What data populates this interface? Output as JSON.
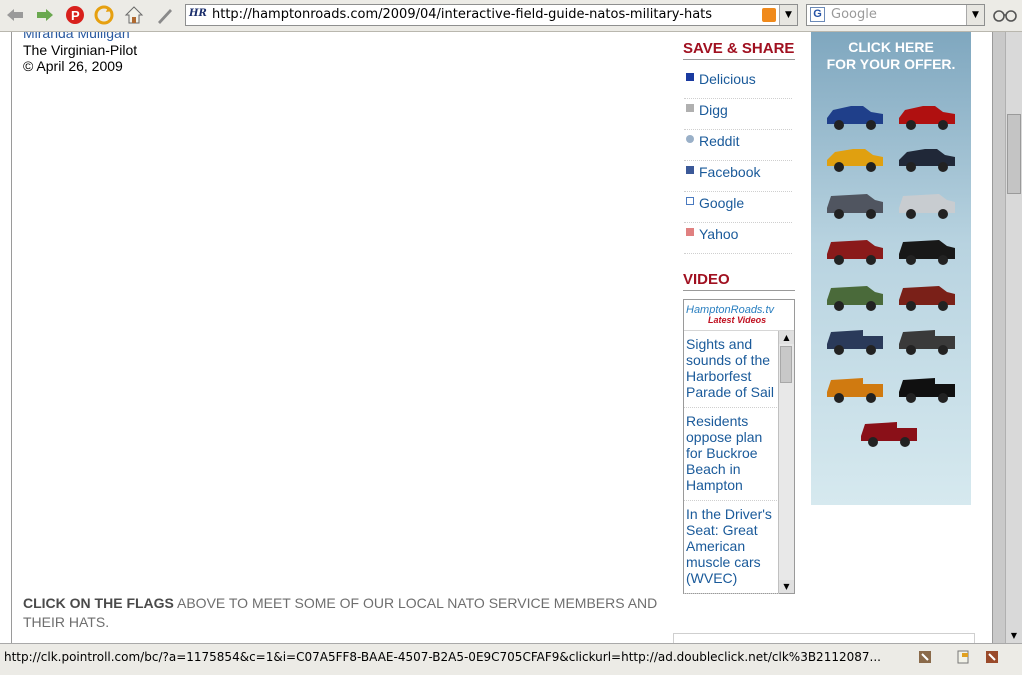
{
  "toolbar": {
    "url": "http://hamptonroads.com/2009/04/interactive-field-guide-natos-military-hats",
    "search_placeholder": "Google",
    "site_favicon_text": "HR"
  },
  "article": {
    "byline_name": "Miranda Mulligan",
    "byline_org": "The Virginian-Pilot",
    "byline_date": "© April 26, 2009",
    "flags_note_bold": "CLICK ON THE FLAGS",
    "flags_note_rest": " ABOVE TO MEET SOME OF OUR LOCAL NATO SERVICE MEMBERS AND THEIR HATS."
  },
  "share": {
    "title": "SAVE & SHARE",
    "items": [
      {
        "label": "Delicious",
        "icon": "delicious-icon",
        "color": "#1a3aa0"
      },
      {
        "label": "Digg",
        "icon": "digg-icon",
        "color": "#9a9a9a"
      },
      {
        "label": "Reddit",
        "icon": "reddit-icon",
        "color": "#9ab0c8"
      },
      {
        "label": "Facebook",
        "icon": "facebook-icon",
        "color": "#3b5998"
      },
      {
        "label": "Google",
        "icon": "google-icon",
        "color": "#4a7ac0"
      },
      {
        "label": "Yahoo",
        "icon": "yahoo-icon",
        "color": "#c03030"
      }
    ]
  },
  "video": {
    "title": "VIDEO",
    "brand": "HamptonRoads.tv",
    "subtitle": "Latest Videos",
    "items": [
      "Sights and sounds of the Harborfest Parade of Sail",
      "Residents oppose plan for Buckroe Beach in Hampton",
      "In the Driver's Seat: Great American muscle cars (WVEC)"
    ]
  },
  "ad": {
    "line1": "CLICK HERE",
    "line2": "FOR YOUR OFFER."
  },
  "status": {
    "text": "http://clk.pointroll.com/bc/?a=1175854&c=1&i=C07A5FF8-BAAE-4507-B2A5-0E9C705CFAF9&clickurl=http://ad.doubleclick.net/clk%3B2112087..."
  },
  "colors": {
    "accent_red": "#a01020",
    "link_blue": "#1a5a9a"
  }
}
